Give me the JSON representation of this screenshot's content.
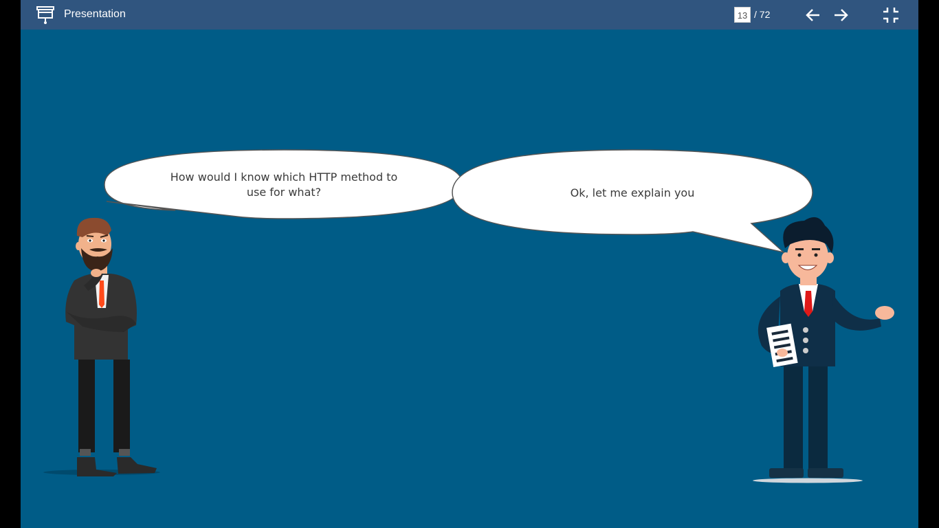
{
  "app": {
    "title": "Presentation"
  },
  "pager": {
    "current": "13",
    "total": "/ 72"
  },
  "icons": {
    "presentation": "presentation-icon",
    "prev": "arrow-left-icon",
    "next": "arrow-right-icon",
    "exit_fullscreen": "exit-fullscreen-icon"
  },
  "slide": {
    "bubble_left": {
      "line1": "How would I know which HTTP method to",
      "line2": "use for what?"
    },
    "bubble_right": {
      "text": "Ok, let me explain you"
    }
  },
  "colors": {
    "slide_bg": "#005c87",
    "topbar_bg": "#30557f"
  }
}
